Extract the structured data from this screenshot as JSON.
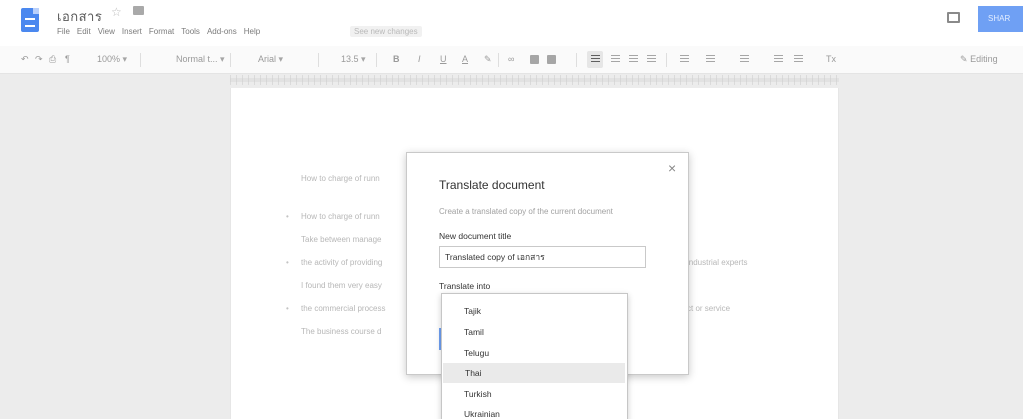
{
  "header": {
    "doc_title": "เอกสาร",
    "menu": [
      "File",
      "Edit",
      "View",
      "Insert",
      "Format",
      "Tools",
      "Add-ons",
      "Help"
    ],
    "see_changes": "See new changes",
    "share_label": "SHAR"
  },
  "toolbar": {
    "zoom": "100%",
    "style": "Normal t...",
    "font": "Arial",
    "font_size": "13.5",
    "bold": "B",
    "italic": "I",
    "underline": "U",
    "text_color": "A",
    "clear_format": "Tx",
    "mode": "Editing"
  },
  "document": {
    "lines": [
      "How to charge of runn",
      "How to charge of runn",
      "Take between manage",
      "the activity of providing",
      "I found them very easy",
      "the commercial process",
      "The business course d"
    ],
    "right_fragments": [
      "industrial experts",
      "ct or service"
    ]
  },
  "dialog": {
    "title": "Translate document",
    "description": "Create a translated copy of the current document",
    "title_label": "New document title",
    "title_value": "Translated copy of เอกสาร",
    "translate_label": "Translate into",
    "languages": [
      "Tajik",
      "Tamil",
      "Telugu",
      "Thai",
      "Turkish",
      "Ukrainian"
    ],
    "selected": "Thai"
  },
  "icons": {
    "doc": "docs-logo-icon",
    "star": "star-icon",
    "folder": "folder-icon",
    "comment": "comment-icon",
    "close": "close-icon"
  },
  "colors": {
    "accent": "#4b88ef",
    "share_button": "#6fa0f4",
    "selected_row": "#eaeaea"
  }
}
